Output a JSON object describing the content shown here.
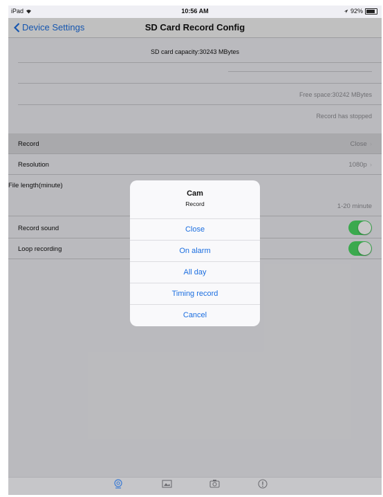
{
  "status": {
    "carrier": "iPad",
    "time": "10:56 AM",
    "battery": "92%"
  },
  "nav": {
    "back_label": "Device Settings",
    "title": "SD Card Record Config"
  },
  "info": {
    "capacity": "SD card capacity:30243 MBytes",
    "used_fraction": 0.0,
    "free_space": "Free space:30242 MBytes",
    "record_status": "Record has stopped"
  },
  "rows": {
    "record": {
      "label": "Record",
      "value": "Close"
    },
    "resolution": {
      "label": "Resolution",
      "value": "1080p"
    },
    "file_length": {
      "label": "File length(minute)",
      "hint": "1-20 minute"
    },
    "record_sound": {
      "label": "Record sound",
      "on": true
    },
    "loop_recording": {
      "label": "Loop recording",
      "on": true
    }
  },
  "sheet": {
    "title": "Cam",
    "message": "Record",
    "options": [
      "Close",
      "On alarm",
      "All day",
      "Timing record"
    ],
    "cancel": "Cancel"
  },
  "tabbar": {
    "items": [
      {
        "icon": "camera-tab-icon",
        "active": true
      },
      {
        "icon": "photos-tab-icon",
        "active": false
      },
      {
        "icon": "album-tab-icon",
        "active": false
      },
      {
        "icon": "about-tab-icon",
        "active": false
      }
    ]
  },
  "colors": {
    "accent": "#1b6ee0",
    "toggle_on": "#4cd964"
  }
}
